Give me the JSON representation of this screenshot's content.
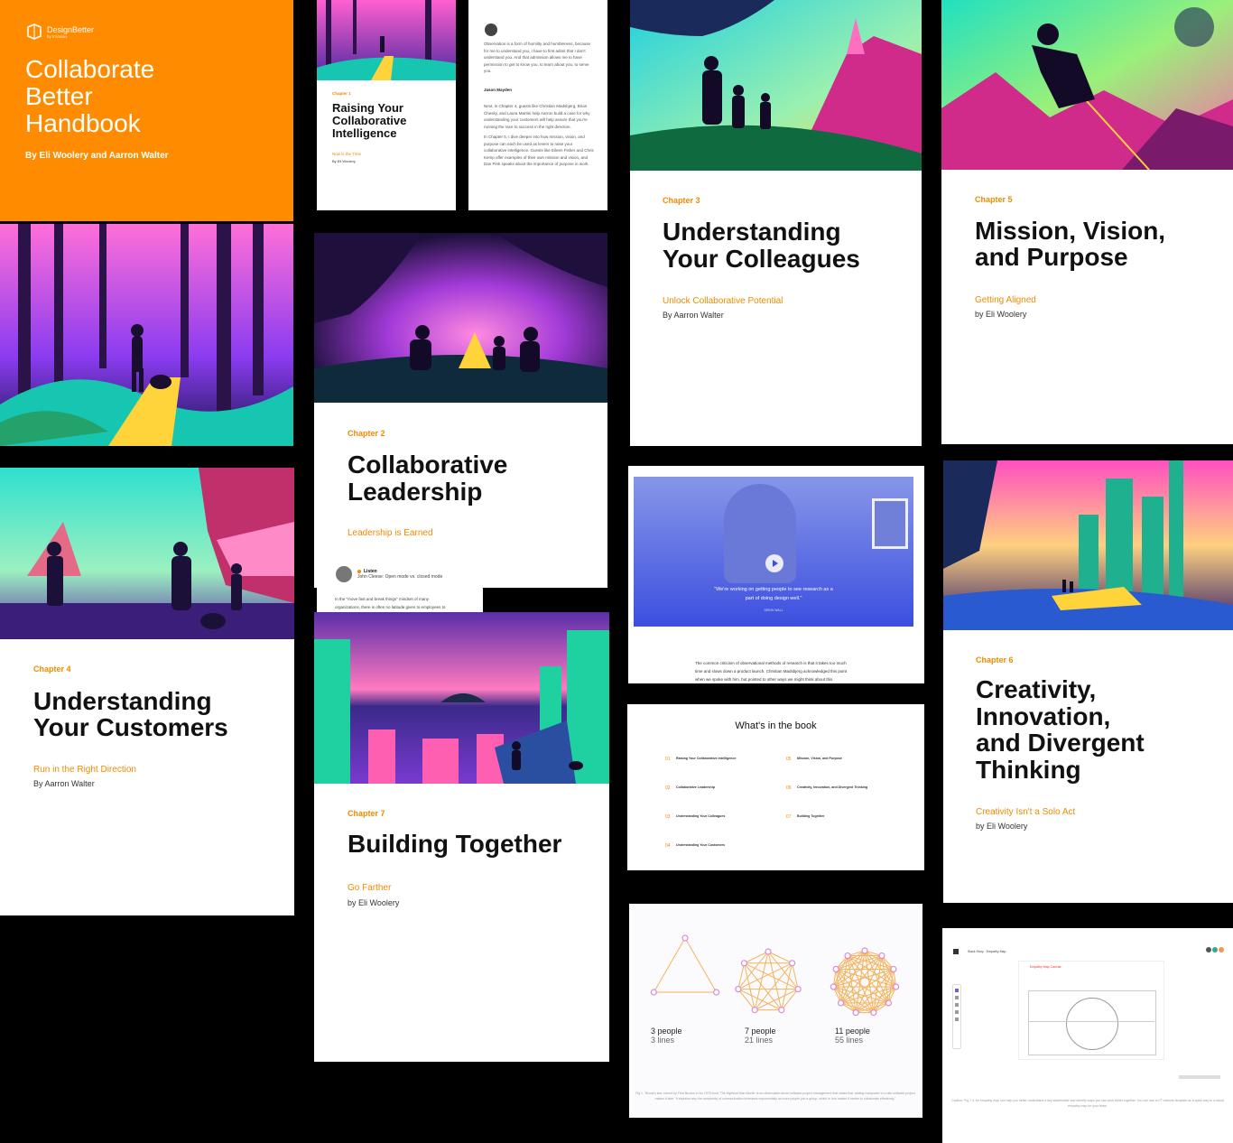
{
  "cover": {
    "brand": "DesignBetter",
    "brand_sub": "by InVision",
    "title_lines": [
      "Collaborate",
      "Better",
      "Handbook"
    ],
    "authors": "By Eli Woolery and Aarron Walter"
  },
  "ch1": {
    "chapter": "Chapter 1",
    "title_lines": [
      "Raising Your",
      "Collaborative",
      "Intelligence"
    ],
    "subtitle": "Now is the Time",
    "byline": "By Eli Woolery"
  },
  "quote_page": {
    "quote": "Observation is a form of humility and humbleness, because for me to understand you, I have to first admit that I don't understand you. And that admission allows me to have permission to get to know you, to learn about you, to serve you.",
    "attribution": "Jason Mayden",
    "para1": "Next, in Chapter 4, guests like Christian Madsbjerg, Brian Chesky, and Laura Martini help Aarron build a case for why understanding your customers will help assure that you're running the race to success in the right direction.",
    "para2": "In Chapter 5, I dive deeper into how mission, vision, and purpose can each be used as levers to raise your collaborative intelligence. Guests like Eileen Fisher and Chris Kemp offer examples of their own mission and vision, and Dan Pink speaks about the importance of purpose in work."
  },
  "ch2": {
    "chapter": "Chapter 2",
    "title_lines": [
      "Collaborative",
      "Leadership"
    ],
    "subtitle": "Leadership is Earned",
    "listen_label": "Listen",
    "listen_track": "John Cleese: Open mode vs. closed mode",
    "text_lines": [
      "In the \"move fast and break things\" mindset of many",
      "organizations, there is often no latitude given to employees to"
    ]
  },
  "ch3": {
    "chapter": "Chapter 3",
    "title_lines": [
      "Understanding",
      "Your Colleagues"
    ],
    "subtitle": "Unlock Collaborative Potential",
    "byline": "By Aarron Walter"
  },
  "ch4": {
    "chapter": "Chapter 4",
    "title_lines": [
      "Understanding",
      "Your Customers"
    ],
    "subtitle": "Run in the Right Direction",
    "byline": "By Aarron Walter"
  },
  "ch5": {
    "chapter": "Chapter 5",
    "title_lines": [
      "Mission, Vision,",
      "and Purpose"
    ],
    "subtitle": "Getting Aligned",
    "byline": "by Eli Woolery"
  },
  "ch6": {
    "chapter": "Chapter 6",
    "title_lines": [
      "Creativity,",
      "Innovation,",
      "and Divergent",
      "Thinking"
    ],
    "subtitle": "Creativity Isn't a Solo Act",
    "byline": "by Eli Woolery"
  },
  "ch7": {
    "chapter": "Chapter 7",
    "title": "Building Together",
    "subtitle": "Go Farther",
    "byline": "by Eli Woolery"
  },
  "video": {
    "quote_lines": [
      "\"We're working on getting people to see research as a",
      "part of doing design well.\""
    ],
    "speaker": "DREW WALL",
    "text_lines": [
      "The common criticism of observational methods of research is that it takes too much",
      "time and slows down a product launch. Christian Madsbjerg acknowledged this point",
      "when we spoke with him, but pointed to other ways we might think about this"
    ]
  },
  "toc": {
    "title": "What's in the book",
    "items": [
      {
        "num": "01",
        "title": "Raising Your Collaborative Intelligence"
      },
      {
        "num": "02",
        "title": "Collaborative Leadership"
      },
      {
        "num": "03",
        "title": "Understanding Your Colleagues"
      },
      {
        "num": "04",
        "title": "Understanding Your Customers"
      },
      {
        "num": "05",
        "title": "Mission, Vision, and Purpose"
      },
      {
        "num": "06",
        "title": "Creativity, Innovation, and Divergent Thinking"
      },
      {
        "num": "07",
        "title": "Building Together"
      }
    ]
  },
  "network": {
    "groups": [
      {
        "people": 3,
        "lines": 3,
        "people_label": "3 people",
        "lines_label": "3 lines"
      },
      {
        "people": 7,
        "lines": 21,
        "people_label": "7 people",
        "lines_label": "21 lines"
      },
      {
        "people": 11,
        "lines": 55,
        "people_label": "11 people",
        "lines_label": "55 lines"
      }
    ],
    "caption": "Fig 1. \"Brook's law, coined by Fred Brooks in his 1975 book 'The Mythical Man-Month' is an observation about software project management that states that 'adding manpower to a late software project makes it later.' It explains why the complexity of communication increases exponentially as more people join a group, which in turn makes it harder to collaborate effectively.\""
  },
  "screenshot": {
    "app_title": "Slack Story · Empathy Map",
    "board_title": "Empathy Map Canvas",
    "caption": "Caption: Fig 7.4: An empathy map can help you better understand a key stakeholder and identify ways you can work better together. You can use an IT network template as a quick way to a visual empathy map for your team."
  },
  "colors": {
    "accent": "#f08a00",
    "cover": "#ff8c00",
    "video_blue": "#3b4fe0"
  }
}
